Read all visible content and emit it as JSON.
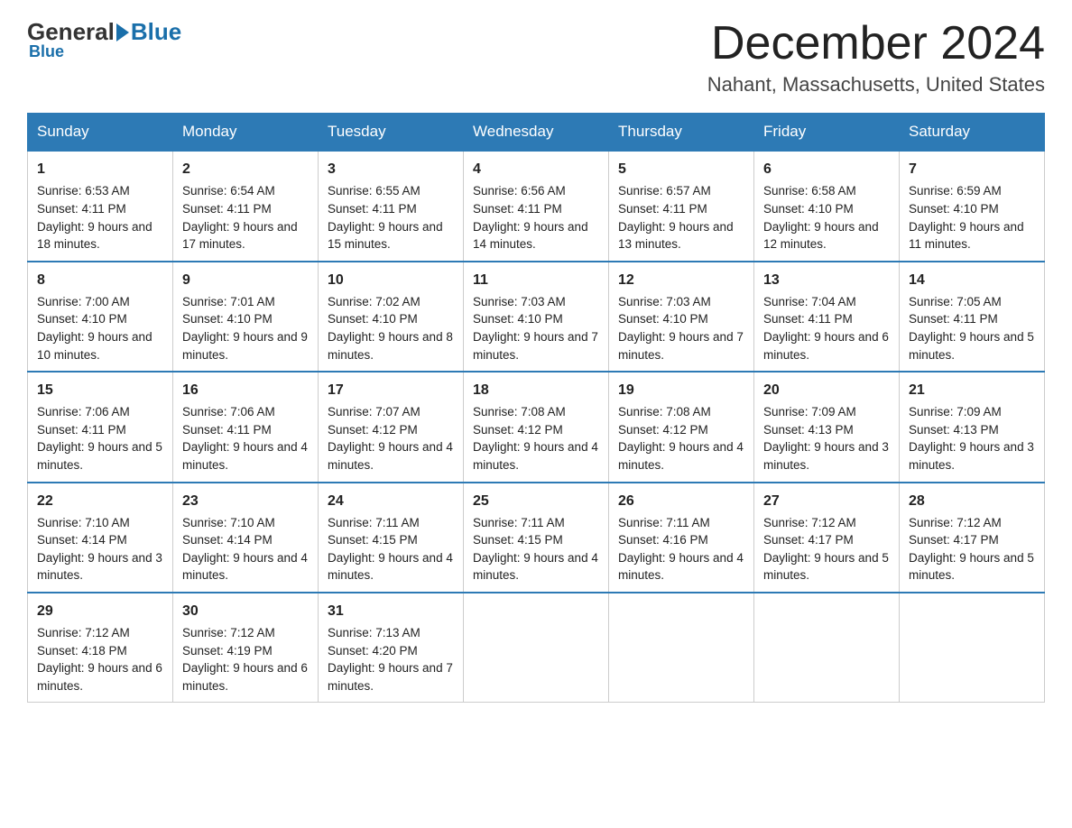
{
  "header": {
    "logo_general": "General",
    "logo_blue": "Blue",
    "month_title": "December 2024",
    "location": "Nahant, Massachusetts, United States"
  },
  "days_of_week": [
    "Sunday",
    "Monday",
    "Tuesday",
    "Wednesday",
    "Thursday",
    "Friday",
    "Saturday"
  ],
  "weeks": [
    [
      {
        "day": "1",
        "sunrise": "6:53 AM",
        "sunset": "4:11 PM",
        "daylight": "9 hours and 18 minutes."
      },
      {
        "day": "2",
        "sunrise": "6:54 AM",
        "sunset": "4:11 PM",
        "daylight": "9 hours and 17 minutes."
      },
      {
        "day": "3",
        "sunrise": "6:55 AM",
        "sunset": "4:11 PM",
        "daylight": "9 hours and 15 minutes."
      },
      {
        "day": "4",
        "sunrise": "6:56 AM",
        "sunset": "4:11 PM",
        "daylight": "9 hours and 14 minutes."
      },
      {
        "day": "5",
        "sunrise": "6:57 AM",
        "sunset": "4:11 PM",
        "daylight": "9 hours and 13 minutes."
      },
      {
        "day": "6",
        "sunrise": "6:58 AM",
        "sunset": "4:10 PM",
        "daylight": "9 hours and 12 minutes."
      },
      {
        "day": "7",
        "sunrise": "6:59 AM",
        "sunset": "4:10 PM",
        "daylight": "9 hours and 11 minutes."
      }
    ],
    [
      {
        "day": "8",
        "sunrise": "7:00 AM",
        "sunset": "4:10 PM",
        "daylight": "9 hours and 10 minutes."
      },
      {
        "day": "9",
        "sunrise": "7:01 AM",
        "sunset": "4:10 PM",
        "daylight": "9 hours and 9 minutes."
      },
      {
        "day": "10",
        "sunrise": "7:02 AM",
        "sunset": "4:10 PM",
        "daylight": "9 hours and 8 minutes."
      },
      {
        "day": "11",
        "sunrise": "7:03 AM",
        "sunset": "4:10 PM",
        "daylight": "9 hours and 7 minutes."
      },
      {
        "day": "12",
        "sunrise": "7:03 AM",
        "sunset": "4:10 PM",
        "daylight": "9 hours and 7 minutes."
      },
      {
        "day": "13",
        "sunrise": "7:04 AM",
        "sunset": "4:11 PM",
        "daylight": "9 hours and 6 minutes."
      },
      {
        "day": "14",
        "sunrise": "7:05 AM",
        "sunset": "4:11 PM",
        "daylight": "9 hours and 5 minutes."
      }
    ],
    [
      {
        "day": "15",
        "sunrise": "7:06 AM",
        "sunset": "4:11 PM",
        "daylight": "9 hours and 5 minutes."
      },
      {
        "day": "16",
        "sunrise": "7:06 AM",
        "sunset": "4:11 PM",
        "daylight": "9 hours and 4 minutes."
      },
      {
        "day": "17",
        "sunrise": "7:07 AM",
        "sunset": "4:12 PM",
        "daylight": "9 hours and 4 minutes."
      },
      {
        "day": "18",
        "sunrise": "7:08 AM",
        "sunset": "4:12 PM",
        "daylight": "9 hours and 4 minutes."
      },
      {
        "day": "19",
        "sunrise": "7:08 AM",
        "sunset": "4:12 PM",
        "daylight": "9 hours and 4 minutes."
      },
      {
        "day": "20",
        "sunrise": "7:09 AM",
        "sunset": "4:13 PM",
        "daylight": "9 hours and 3 minutes."
      },
      {
        "day": "21",
        "sunrise": "7:09 AM",
        "sunset": "4:13 PM",
        "daylight": "9 hours and 3 minutes."
      }
    ],
    [
      {
        "day": "22",
        "sunrise": "7:10 AM",
        "sunset": "4:14 PM",
        "daylight": "9 hours and 3 minutes."
      },
      {
        "day": "23",
        "sunrise": "7:10 AM",
        "sunset": "4:14 PM",
        "daylight": "9 hours and 4 minutes."
      },
      {
        "day": "24",
        "sunrise": "7:11 AM",
        "sunset": "4:15 PM",
        "daylight": "9 hours and 4 minutes."
      },
      {
        "day": "25",
        "sunrise": "7:11 AM",
        "sunset": "4:15 PM",
        "daylight": "9 hours and 4 minutes."
      },
      {
        "day": "26",
        "sunrise": "7:11 AM",
        "sunset": "4:16 PM",
        "daylight": "9 hours and 4 minutes."
      },
      {
        "day": "27",
        "sunrise": "7:12 AM",
        "sunset": "4:17 PM",
        "daylight": "9 hours and 5 minutes."
      },
      {
        "day": "28",
        "sunrise": "7:12 AM",
        "sunset": "4:17 PM",
        "daylight": "9 hours and 5 minutes."
      }
    ],
    [
      {
        "day": "29",
        "sunrise": "7:12 AM",
        "sunset": "4:18 PM",
        "daylight": "9 hours and 6 minutes."
      },
      {
        "day": "30",
        "sunrise": "7:12 AM",
        "sunset": "4:19 PM",
        "daylight": "9 hours and 6 minutes."
      },
      {
        "day": "31",
        "sunrise": "7:13 AM",
        "sunset": "4:20 PM",
        "daylight": "9 hours and 7 minutes."
      },
      null,
      null,
      null,
      null
    ]
  ],
  "labels": {
    "sunrise": "Sunrise:",
    "sunset": "Sunset:",
    "daylight": "Daylight:"
  }
}
